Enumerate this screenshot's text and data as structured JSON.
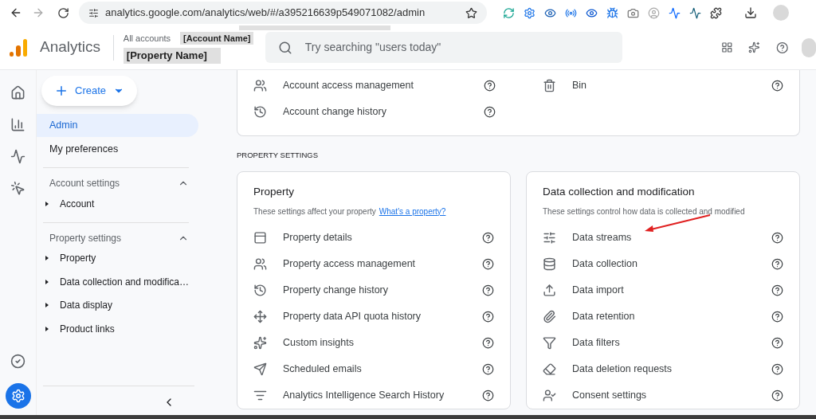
{
  "browser": {
    "url": "analytics.google.com/analytics/web/#/a395216639p549071082/admin"
  },
  "header": {
    "product": "Analytics",
    "breadcrumb": "All accounts",
    "account_label": "[Account Name]",
    "property_label": "[Property Name]",
    "search": {
      "placeholder": "Try searching \"users today\""
    }
  },
  "rail": [
    {
      "selected": false
    },
    {
      "selected": false
    },
    {
      "selected": false
    },
    {
      "selected": false
    }
  ],
  "rail_bottom": [
    {
      "selected": false
    },
    {
      "selected": true
    }
  ],
  "sidebar": {
    "create": "Create",
    "items": [
      {
        "label": "Admin",
        "selected": true
      },
      {
        "label": "My preferences",
        "selected": false
      }
    ],
    "sections": [
      {
        "title": "Account settings",
        "expanded": true,
        "items": [
          "Account"
        ]
      },
      {
        "title": "Property settings",
        "expanded": true,
        "items": [
          "Property",
          "Data collection and modifica…",
          "Data display",
          "Product links"
        ]
      }
    ]
  },
  "account_card": {
    "left": [
      "Account access management",
      "Account change history"
    ],
    "right": [
      "Bin"
    ]
  },
  "section_heading": "PROPERTY SETTINGS",
  "cards": [
    {
      "title": "Property",
      "description": "These settings affect your property",
      "link": "What's a property?",
      "items": [
        "Property details",
        "Property access management",
        "Property change history",
        "Property data API quota history",
        "Custom insights",
        "Scheduled emails",
        "Analytics Intelligence Search History"
      ]
    },
    {
      "title": "Data collection and modification",
      "description": "These settings control how data is collected and modified",
      "items": [
        "Data streams",
        "Data collection",
        "Data import",
        "Data retention",
        "Data filters",
        "Data deletion requests",
        "Consent settings"
      ]
    }
  ]
}
